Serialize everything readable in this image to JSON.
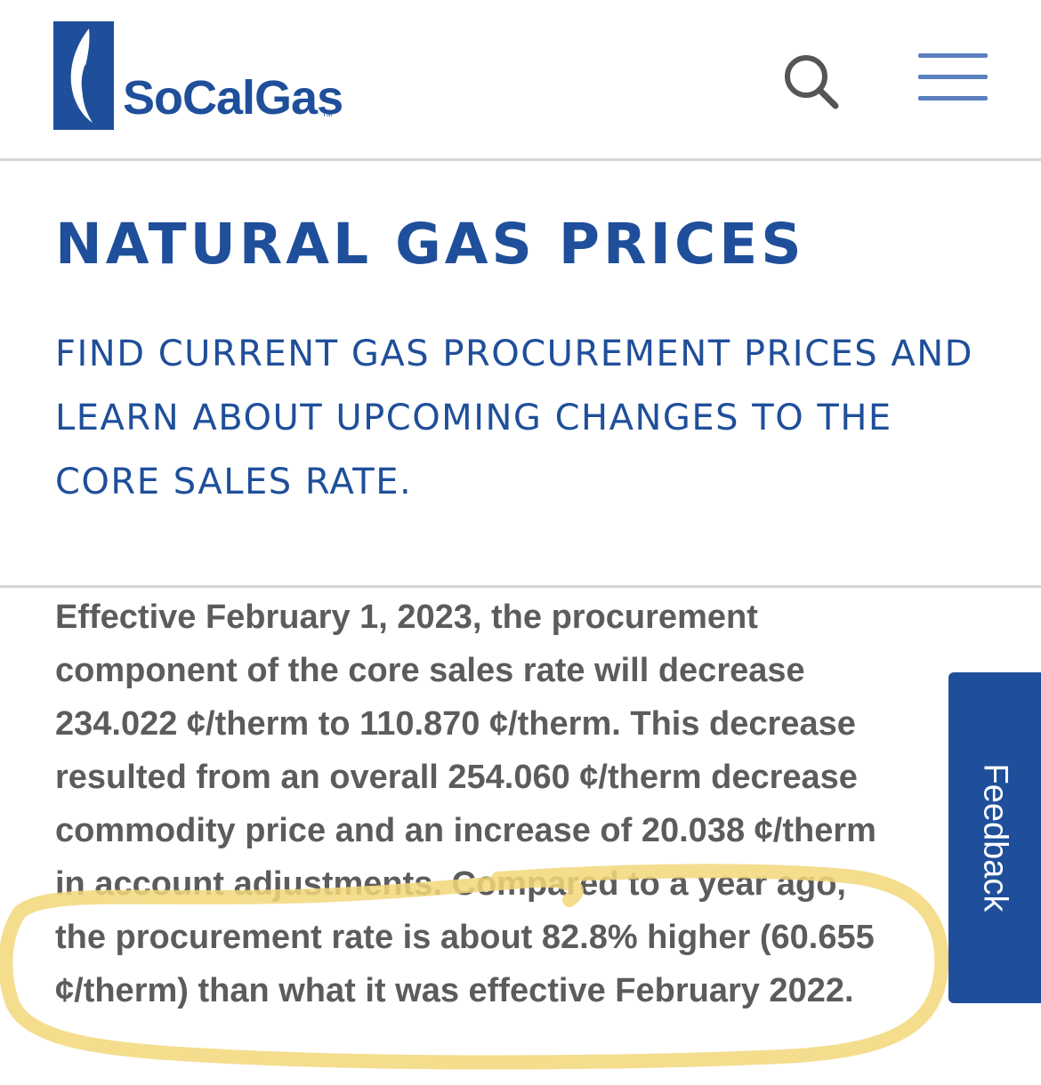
{
  "header": {
    "logo_text": "SoCalGas",
    "logo_tm": "TM",
    "search_icon": "search-icon",
    "menu_icon": "hamburger-menu-icon"
  },
  "main": {
    "title": "NATURAL GAS PRICES",
    "subtitle": "FIND CURRENT GAS PROCUREMENT PRICES AND LEARN ABOUT UPCOMING CHANGES TO THE CORE SALES RATE.",
    "body_lines": [
      "Effective February 1, 2023, the procurement",
      "component of the core sales rate will decrease",
      "234.022 ¢/therm to 110.870 ¢/therm. This decrease",
      "resulted from an overall 254.060 ¢/therm decrease",
      "commodity price and an increase of 20.038 ¢/therm",
      "in account adjustments. Compared to a year ago,",
      "the procurement rate is about 82.8% higher (60.655",
      "¢/therm) than what it was effective February 2022."
    ]
  },
  "feedback": {
    "label": "Feedback"
  },
  "colors": {
    "brand_blue": "#1f4f9a",
    "body_text": "#5c5c5c",
    "highlight": "#f3d77a"
  }
}
